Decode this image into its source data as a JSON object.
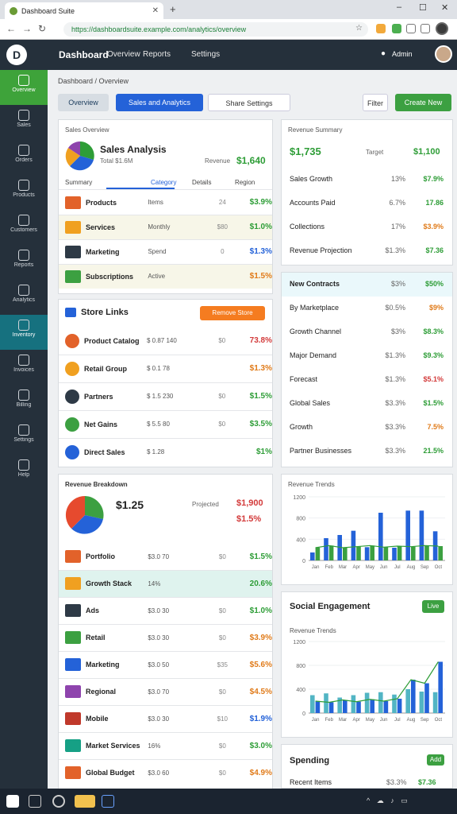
{
  "browser": {
    "tab_title": "Dashboard Suite",
    "url": "https://dashboardsuite.example.com/analytics/overview",
    "minimize": "–",
    "maximize": "☐",
    "close": "✕"
  },
  "app": {
    "logo_letter": "D",
    "title": "Dashboard",
    "nav": [
      "Overview",
      "Reports",
      "Settings"
    ],
    "user_label": "Admin"
  },
  "sidebar": {
    "items": [
      {
        "label": "Overview",
        "icon": "home-icon"
      },
      {
        "label": "Sales",
        "icon": "chart-icon"
      },
      {
        "label": "Orders",
        "icon": "cart-icon"
      },
      {
        "label": "Products",
        "icon": "box-icon"
      },
      {
        "label": "Customers",
        "icon": "users-icon"
      },
      {
        "label": "Reports",
        "icon": "report-icon"
      },
      {
        "label": "Analytics",
        "icon": "analytics-icon"
      },
      {
        "label": "Inventory",
        "icon": "inventory-icon"
      },
      {
        "label": "Invoices",
        "icon": "invoice-icon"
      },
      {
        "label": "Billing",
        "icon": "billing-icon"
      },
      {
        "label": "Settings",
        "icon": "gear-icon"
      },
      {
        "label": "Help",
        "icon": "help-icon"
      }
    ]
  },
  "toolbar": {
    "breadcrumb": "Dashboard / Overview",
    "btn_overview": "Overview",
    "btn_analytics": "Sales and Analytics",
    "btn_settings": "Share Settings",
    "btn_filter": "Filter",
    "btn_create": "Create New"
  },
  "card1": {
    "header": "Sales Overview",
    "title": "Sales Analysis",
    "subtitle": "Total $1.6M",
    "legend_label": "Revenue",
    "legend_value": "$1,640",
    "tabs": [
      "Summary",
      "Category",
      "Details",
      "Region"
    ],
    "rows": [
      {
        "name": "Products",
        "sub": "Items",
        "mid": "24",
        "value": "$3.9%",
        "tone": "green"
      },
      {
        "name": "Services",
        "sub": "Monthly",
        "mid": "$80",
        "value": "$1.0%",
        "tone": "green"
      },
      {
        "name": "Marketing",
        "sub": "Spend",
        "mid": "0",
        "value": "$1.3%",
        "tone": "blue"
      },
      {
        "name": "Subscriptions",
        "sub": "Active",
        "mid": "",
        "value": "$1.5%",
        "tone": "orange"
      }
    ]
  },
  "card2": {
    "title": "Store Links",
    "action": "Remove Store",
    "rows": [
      {
        "name": "Product Catalog",
        "sub": "$ 0.87 140",
        "mid": "$0",
        "value": "73.8%",
        "tone": "red"
      },
      {
        "name": "Retail Group",
        "sub": "$ 0.1 78",
        "mid": "",
        "value": "$1.3%",
        "tone": "orange"
      },
      {
        "name": "Partners",
        "sub": "$ 1.5 230",
        "mid": "$0",
        "value": "$1.5%",
        "tone": "green"
      },
      {
        "name": "Net Gains",
        "sub": "$ 5.5 80",
        "mid": "$0",
        "value": "$3.5%",
        "tone": "green"
      },
      {
        "name": "Direct Sales",
        "sub": "$ 1.28",
        "mid": "",
        "value": "$1%",
        "tone": "green"
      }
    ]
  },
  "card3": {
    "header": "Revenue Breakdown",
    "big_value": "$1.25",
    "legend_label": "Projected",
    "legend_value": "$1,900",
    "legend_pct": "$1.5%",
    "rows": [
      {
        "name": "Portfolio",
        "sub": "$3.0 70",
        "mid": "$0",
        "value": "$1.5%",
        "tone": "green"
      },
      {
        "name": "Growth Stack",
        "sub": "14%",
        "mid": "",
        "value": "20.6%",
        "tone": "green"
      },
      {
        "name": "Ads",
        "sub": "$3.0 30",
        "mid": "$0",
        "value": "$1.0%",
        "tone": "green"
      },
      {
        "name": "Retail",
        "sub": "$3.0 30",
        "mid": "$0",
        "value": "$3.9%",
        "tone": "orange"
      },
      {
        "name": "Marketing",
        "sub": "$3.0 50",
        "mid": "$35",
        "value": "$5.6%",
        "tone": "orange"
      },
      {
        "name": "Regional",
        "sub": "$3.0 70",
        "mid": "$0",
        "value": "$4.5%",
        "tone": "orange"
      },
      {
        "name": "Mobile",
        "sub": "$3.0 30",
        "mid": "$10",
        "value": "$1.9%",
        "tone": "blue"
      },
      {
        "name": "Market Services",
        "sub": "16%",
        "mid": "$0",
        "value": "$3.0%",
        "tone": "green"
      },
      {
        "name": "Global Budget",
        "sub": "$3.0 60",
        "mid": "$0",
        "value": "$4.9%",
        "tone": "orange"
      }
    ]
  },
  "rcard1": {
    "header": "Revenue Summary",
    "big": "$1,735",
    "big_label": "Target",
    "big_value": "$1,100",
    "rows": [
      {
        "label": "Sales Growth",
        "pct": "13%",
        "value": "$7.9%",
        "tone": "green"
      },
      {
        "label": "Accounts Paid",
        "pct": "6.7%",
        "value": "17.86",
        "tone": "green"
      },
      {
        "label": "Collections",
        "pct": "17%",
        "value": "$3.9%",
        "tone": "orange"
      },
      {
        "label": "Revenue Projection",
        "pct": "$1.3%",
        "value": "$7.36",
        "tone": "green"
      }
    ]
  },
  "rcard2": {
    "rows": [
      {
        "label": "New Contracts",
        "pct": "$3%",
        "value": "$50%",
        "tone": "green"
      },
      {
        "label": "By Marketplace",
        "pct": "$0.5%",
        "value": "$9%",
        "tone": "orange"
      },
      {
        "label": "Growth Channel",
        "pct": "$3%",
        "value": "$8.3%",
        "tone": "green"
      },
      {
        "label": "Major Demand",
        "pct": "$1.3%",
        "value": "$9.3%",
        "tone": "green"
      },
      {
        "label": "Forecast",
        "pct": "$1.3%",
        "value": "$5.1%",
        "tone": "red"
      },
      {
        "label": "Global Sales",
        "pct": "$3.3%",
        "value": "$1.5%",
        "tone": "green"
      },
      {
        "label": "Growth",
        "pct": "$3.3%",
        "value": "7.5%",
        "tone": "orange"
      },
      {
        "label": "Partner Businesses",
        "pct": "$3.3%",
        "value": "21.5%",
        "tone": "green"
      }
    ]
  },
  "chart_data": [
    {
      "type": "bar",
      "title": "Revenue Trends",
      "y_ticks": [
        "1200",
        "800",
        "400",
        "0"
      ],
      "categories": [
        "Jan",
        "Feb",
        "Mar",
        "Apr",
        "May",
        "Jun",
        "Jul",
        "Aug",
        "Sep",
        "Oct"
      ],
      "series": [
        {
          "values": [
            150,
            420,
            480,
            560,
            250,
            900,
            240,
            940,
            940,
            550
          ]
        },
        {
          "values": [
            240,
            280,
            240,
            260,
            280,
            250,
            270,
            260,
            280,
            270
          ]
        }
      ],
      "ylim": [
        0,
        1200
      ]
    },
    {
      "type": "bar",
      "title": "Social Engagement",
      "badge": "Live",
      "sub": "Revenue Trends",
      "y_ticks": [
        "1200",
        "800",
        "400",
        "0"
      ],
      "categories": [
        "Jan",
        "Feb",
        "Mar",
        "Apr",
        "May",
        "Jun",
        "Jul",
        "Aug",
        "Sep",
        "Oct"
      ],
      "series": [
        {
          "values": [
            300,
            330,
            260,
            300,
            340,
            350,
            310,
            400,
            360,
            350
          ]
        },
        {
          "values": [
            200,
            180,
            220,
            190,
            230,
            200,
            240,
            560,
            500,
            860
          ]
        }
      ],
      "ylim": [
        0,
        1200
      ]
    }
  ],
  "bottom_card": {
    "title": "Spending",
    "badge": "Add",
    "row_label": "Recent Items",
    "row_pct": "$3.3%",
    "row_value": "$7.36"
  }
}
